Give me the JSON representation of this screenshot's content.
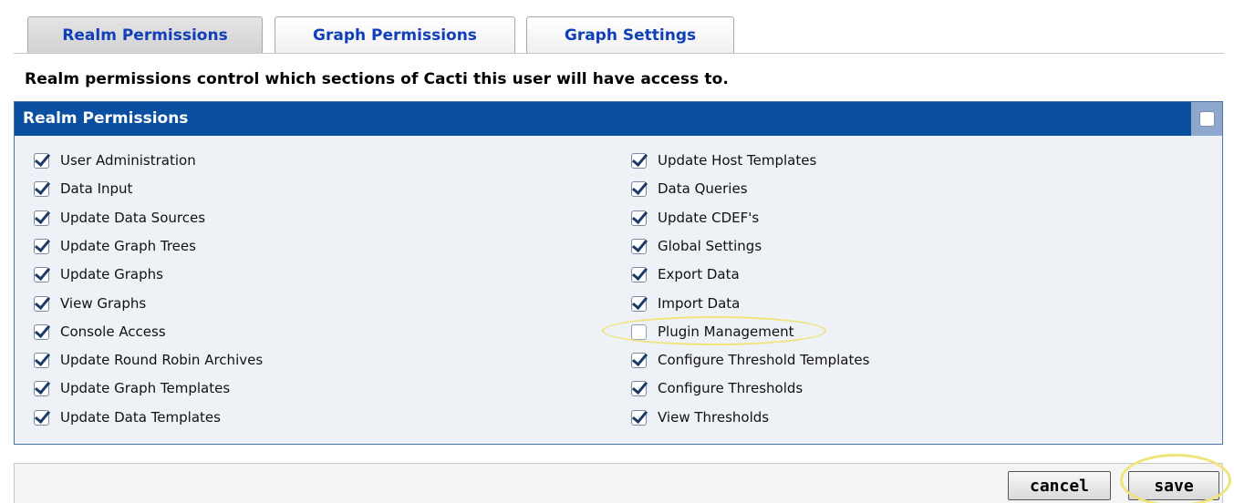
{
  "tabs": [
    {
      "label": "Realm Permissions",
      "active": true
    },
    {
      "label": "Graph Permissions",
      "active": false
    },
    {
      "label": "Graph Settings",
      "active": false
    }
  ],
  "description": "Realm permissions control which sections of Cacti this user will have access to.",
  "panel": {
    "title": "Realm Permissions",
    "select_all_checked": false,
    "left_column": [
      {
        "label": "User Administration",
        "checked": true
      },
      {
        "label": "Data Input",
        "checked": true
      },
      {
        "label": "Update Data Sources",
        "checked": true
      },
      {
        "label": "Update Graph Trees",
        "checked": true
      },
      {
        "label": "Update Graphs",
        "checked": true
      },
      {
        "label": "View Graphs",
        "checked": true
      },
      {
        "label": "Console Access",
        "checked": true
      },
      {
        "label": "Update Round Robin Archives",
        "checked": true
      },
      {
        "label": "Update Graph Templates",
        "checked": true
      },
      {
        "label": "Update Data Templates",
        "checked": true
      }
    ],
    "right_column": [
      {
        "label": "Update Host Templates",
        "checked": true
      },
      {
        "label": "Data Queries",
        "checked": true
      },
      {
        "label": "Update CDEF's",
        "checked": true
      },
      {
        "label": "Global Settings",
        "checked": true
      },
      {
        "label": "Export Data",
        "checked": true
      },
      {
        "label": "Import Data",
        "checked": true
      },
      {
        "label": "Plugin Management",
        "checked": false
      },
      {
        "label": "Configure Threshold Templates",
        "checked": true
      },
      {
        "label": "Configure Thresholds",
        "checked": true
      },
      {
        "label": "View Thresholds",
        "checked": true
      }
    ]
  },
  "buttons": {
    "cancel_label": "cancel",
    "save_label": "save"
  },
  "colors": {
    "tab_text": "#1040b8",
    "panel_header": "#0a4fa0",
    "panel_body": "#eef1f6",
    "highlight": "#f0e37a"
  }
}
